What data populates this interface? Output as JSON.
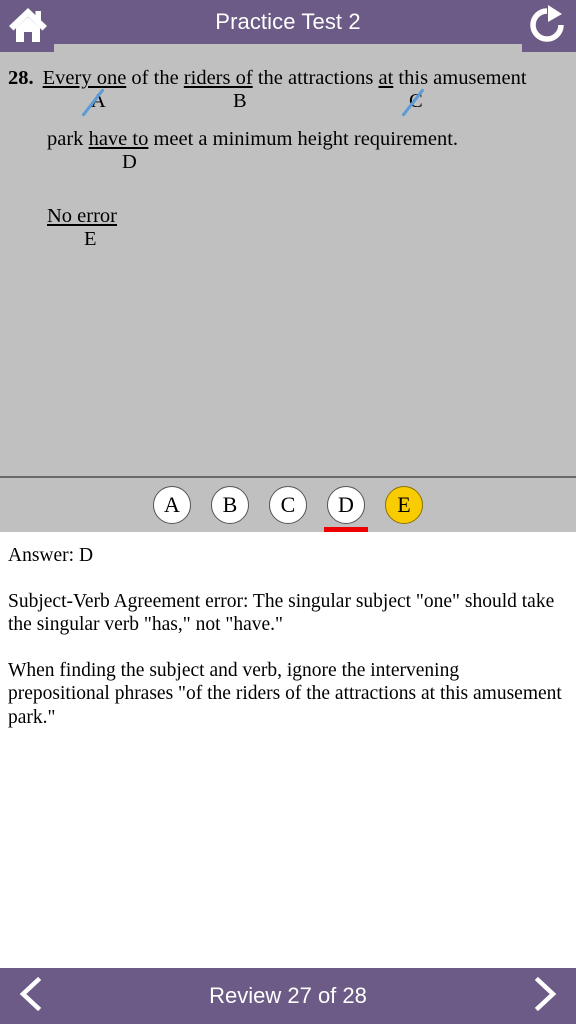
{
  "header": {
    "title": "Practice Test 2",
    "home_icon": "home-icon",
    "refresh_icon": "refresh-icon"
  },
  "question": {
    "number": "28.",
    "line1": [
      {
        "text": "Every one",
        "underlined": true
      },
      {
        "text": " of the ",
        "underlined": false
      },
      {
        "text": "riders of",
        "underlined": true
      },
      {
        "text": " the attractions ",
        "underlined": false
      },
      {
        "text": "at",
        "underlined": true
      },
      {
        "text": " this amusement",
        "underlined": false
      }
    ],
    "line1_labels": [
      {
        "label": "A",
        "struck": true
      },
      {
        "label": "B",
        "struck": false
      },
      {
        "label": "C",
        "struck": true
      }
    ],
    "line2": [
      {
        "text": "park ",
        "underlined": false
      },
      {
        "text": "have to",
        "underlined": true
      },
      {
        "text": " meet a minimum height requirement.",
        "underlined": false
      }
    ],
    "line2_labels": [
      {
        "label": "D",
        "struck": false
      }
    ],
    "line3": [
      {
        "text": "No error",
        "underlined": true
      }
    ],
    "line3_labels": [
      {
        "label": "E",
        "struck": false
      }
    ]
  },
  "choices": [
    {
      "label": "A",
      "selected": false,
      "correct": false
    },
    {
      "label": "B",
      "selected": false,
      "correct": false
    },
    {
      "label": "C",
      "selected": false,
      "correct": false
    },
    {
      "label": "D",
      "selected": false,
      "correct": true
    },
    {
      "label": "E",
      "selected": true,
      "correct": false
    }
  ],
  "explanation": {
    "answer_line": "Answer:  D",
    "paragraphs": [
      "Subject-Verb Agreement error:  The singular subject \"one\" should take the singular verb \"has,\" not \"have.\"",
      "When finding the subject and verb, ignore the intervening prepositional phrases \"of the riders of the attractions at this amusement park.\""
    ]
  },
  "footer": {
    "label": "Review 27 of 28",
    "prev_icon": "chevron-left-icon",
    "next_icon": "chevron-right-icon"
  },
  "colors": {
    "brand_purple": "#6b5b86",
    "panel_gray": "#c0c0c0",
    "selected_yellow": "#f8cc00",
    "correct_red": "#ee0000",
    "mark_blue": "#5a9bd8"
  }
}
